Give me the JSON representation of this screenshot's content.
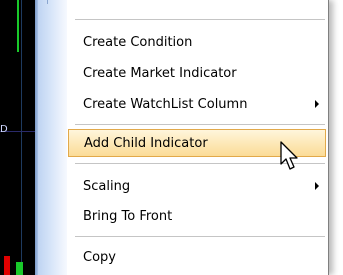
{
  "context_menu": {
    "items": [
      {
        "label": "Create Condition",
        "submenu": false,
        "highlighted": false
      },
      {
        "label": "Create Market Indicator",
        "submenu": false,
        "highlighted": false
      },
      {
        "label": "Create WatchList Column",
        "submenu": true,
        "highlighted": false
      },
      {
        "label": "Add Child Indicator",
        "submenu": false,
        "highlighted": true
      },
      {
        "label": "Scaling",
        "submenu": true,
        "highlighted": false
      },
      {
        "label": "Bring To Front",
        "submenu": false,
        "highlighted": false
      },
      {
        "label": "Copy",
        "submenu": false,
        "highlighted": false
      }
    ]
  },
  "background_chart": {
    "axis_label": "D"
  },
  "colors": {
    "highlight_bg": "#fde9b8",
    "highlight_border": "#e2a94a",
    "gutter": "#c9dcf5",
    "chart_green": "#19c92a",
    "chart_red": "#e00000"
  },
  "icons": {
    "submenu": "chevron-right-icon",
    "pointer": "mouse-pointer-icon"
  }
}
